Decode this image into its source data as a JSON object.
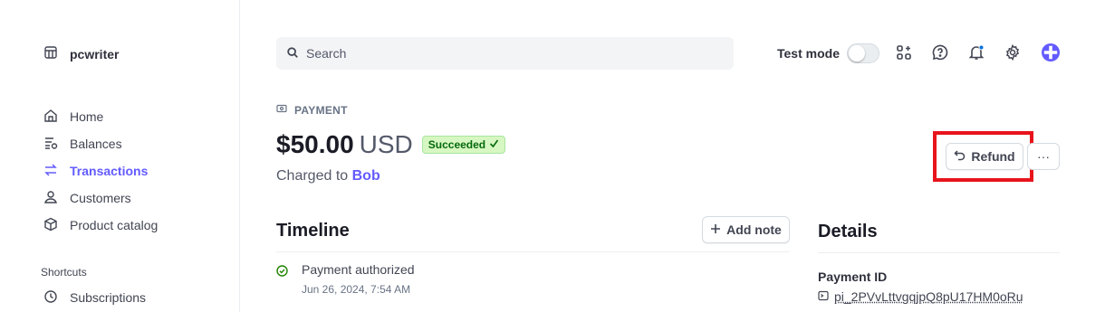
{
  "account": {
    "name": "pcwriter",
    "icon": "store-icon"
  },
  "sidebar": {
    "items": [
      {
        "label": "Home",
        "icon": "home-icon",
        "active": false
      },
      {
        "label": "Balances",
        "icon": "balances-icon",
        "active": false
      },
      {
        "label": "Transactions",
        "icon": "arrows-swap-icon",
        "active": true
      },
      {
        "label": "Customers",
        "icon": "person-icon",
        "active": false
      },
      {
        "label": "Product catalog",
        "icon": "box-icon",
        "active": false
      }
    ],
    "shortcuts_title": "Shortcuts",
    "shortcuts": [
      {
        "label": "Subscriptions",
        "icon": "clock-icon"
      }
    ]
  },
  "topbar": {
    "search_placeholder": "Search",
    "test_mode_label": "Test mode",
    "test_mode_on": false,
    "icons": [
      "apps-icon",
      "help-icon",
      "bell-icon",
      "gear-icon",
      "plus-icon"
    ]
  },
  "payment": {
    "eyebrow": "PAYMENT",
    "amount": "$50.00",
    "currency": "USD",
    "status": "Succeeded",
    "charged_prefix": "Charged to",
    "customer": "Bob"
  },
  "actions": {
    "refund_label": "Refund",
    "more_label": "···"
  },
  "timeline": {
    "title": "Timeline",
    "add_note_label": "Add note",
    "events": [
      {
        "title": "Payment authorized",
        "time": "Jun 26, 2024, 7:54 AM"
      }
    ]
  },
  "details": {
    "title": "Details",
    "fields": [
      {
        "label": "Payment ID",
        "value": "pi_2PVvLttvgqjpQ8pU17HM0oRu"
      }
    ]
  },
  "colors": {
    "accent": "#635bff",
    "success_bg": "#d7f7c2",
    "success_text": "#05690d",
    "highlight": "#e8141c"
  }
}
